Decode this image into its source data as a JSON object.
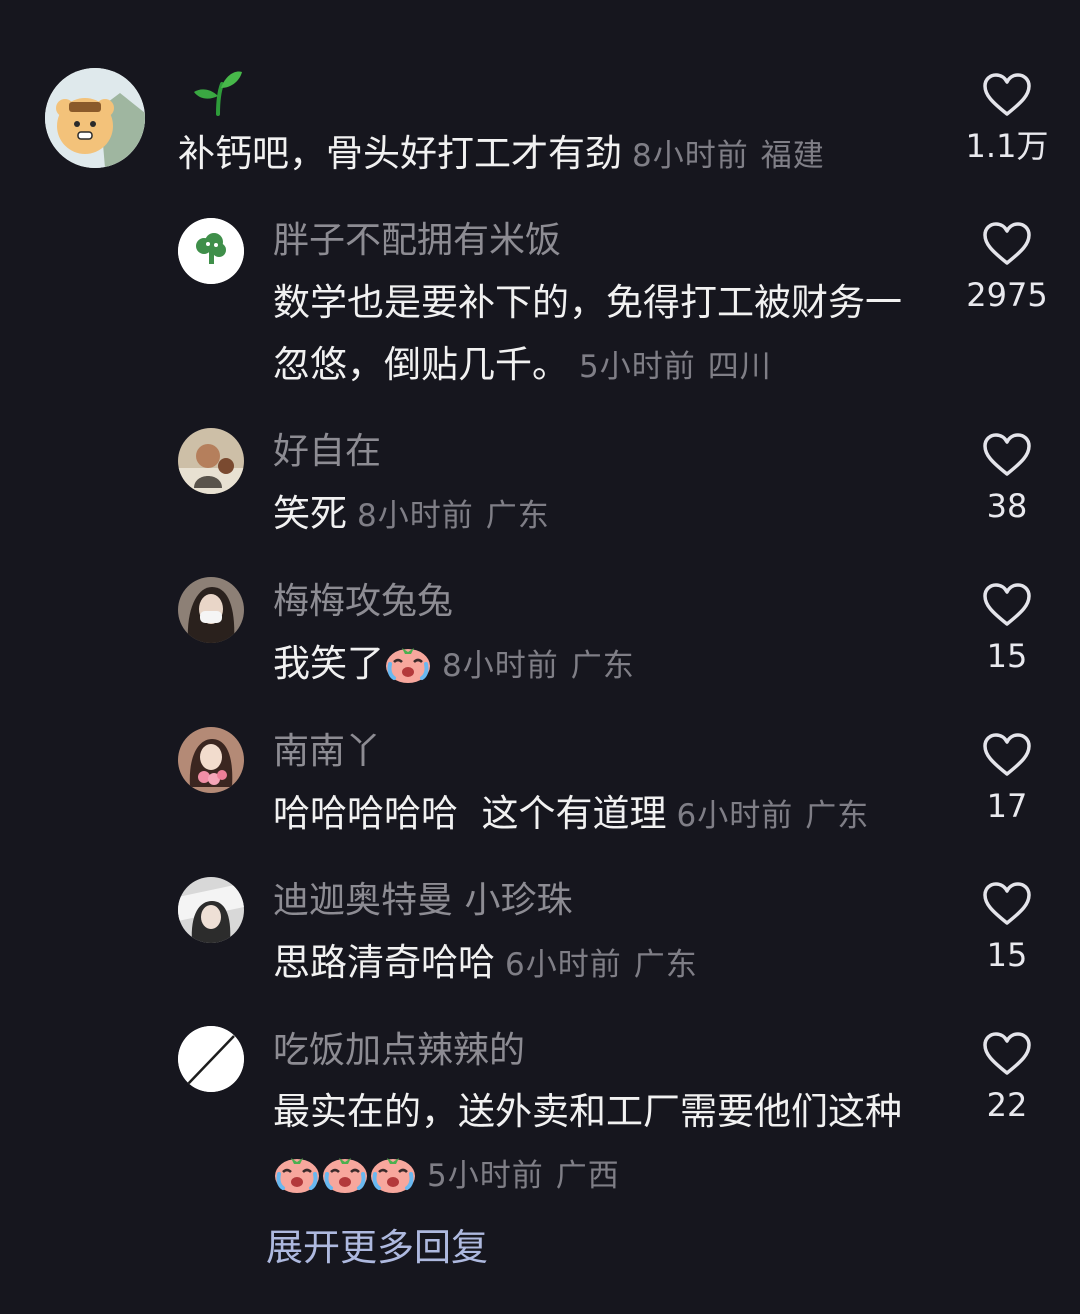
{
  "main_comment": {
    "badge_icon": "sprout-icon",
    "text": "补钙吧，骨头好打工才有劲",
    "time": "8小时前",
    "location": "福建",
    "likes": "1.1万"
  },
  "replies": [
    {
      "username": "胖子不配拥有米饭",
      "text": "数学也是要补下的，免得打工被财务一忽悠，倒贴几千。",
      "time": "5小时前",
      "location": "四川",
      "likes": "2975"
    },
    {
      "username": "好自在",
      "text": "笑死",
      "time": "8小时前",
      "location": "广东",
      "likes": "38"
    },
    {
      "username": "梅梅攻兔兔",
      "text": "我笑了",
      "emoji": [
        "crying-face-emoji"
      ],
      "time": "8小时前",
      "location": "广东",
      "likes": "15"
    },
    {
      "username": "南南丫",
      "text": "哈哈哈哈哈  这个有道理",
      "time": "6小时前",
      "location": "广东",
      "likes": "17"
    },
    {
      "username": "迪迦奥特曼 小珍珠",
      "text": "思路清奇哈哈",
      "time": "6小时前",
      "location": "广东",
      "likes": "15"
    },
    {
      "username": "吃饭加点辣辣的",
      "text": "最实在的，送外卖和工厂需要他们这种",
      "emoji": [
        "crying-face-emoji",
        "crying-face-emoji",
        "crying-face-emoji"
      ],
      "time": "5小时前",
      "location": "广西",
      "likes": "22"
    }
  ],
  "expand_label": "展开更多回复",
  "colors": {
    "background": "#16161e",
    "username": "#8d8c93",
    "meta": "#7f7e86",
    "expand_link": "#aeb9df"
  }
}
